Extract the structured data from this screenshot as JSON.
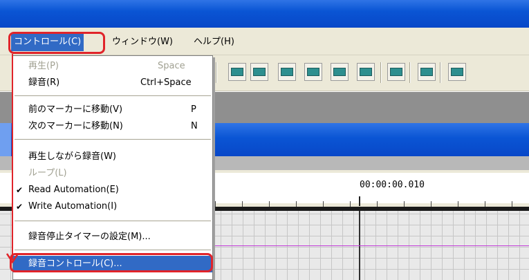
{
  "menubar": {
    "items": [
      {
        "label": "コントロール(C)"
      },
      {
        "label": "ウィンドウ(W)"
      },
      {
        "label": "ヘルプ(H)"
      }
    ]
  },
  "timeline": {
    "time": "00:00:00.010"
  },
  "dropdown": {
    "play": {
      "label": "再生(P)",
      "shortcut": "Space"
    },
    "record": {
      "label": "録音(R)",
      "shortcut": "Ctrl+Space"
    },
    "prev_marker": {
      "label": "前のマーカーに移動(V)",
      "shortcut": "P"
    },
    "next_marker": {
      "label": "次のマーカーに移動(N)",
      "shortcut": "N"
    },
    "record_while_playing": {
      "label": "再生しながら録音(W)"
    },
    "loop": {
      "label": "ループ(L)"
    },
    "read_automation": {
      "label": "Read Automation(E)",
      "checked": "✔"
    },
    "write_automation": {
      "label": "Write Automation(I)",
      "checked": "✔"
    },
    "stop_timer": {
      "label": "録音停止タイマーの設定(M)..."
    },
    "record_control": {
      "label": "録音コントロール(C)..."
    }
  },
  "annotation_color": "#e0242a"
}
